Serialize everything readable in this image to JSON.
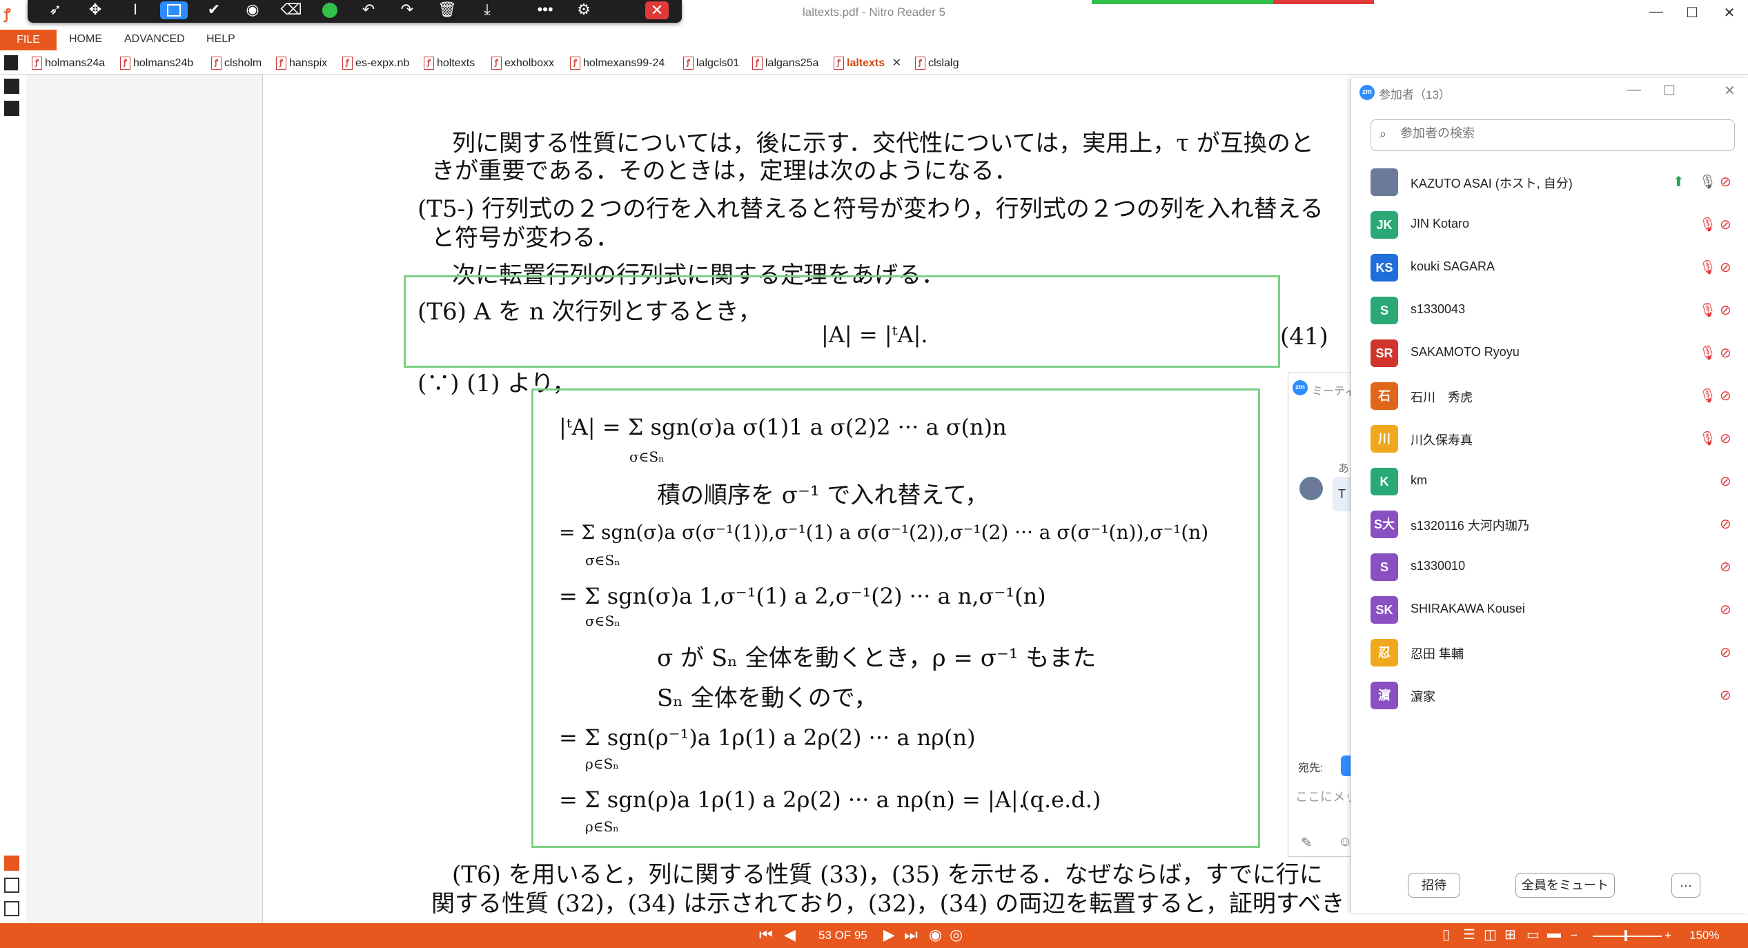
{
  "window": {
    "title": "laltexts.pdf - Nitro Reader 5",
    "min": "—",
    "max": "☐",
    "close": "✕"
  },
  "menu": {
    "file": "FILE",
    "home": "HOME",
    "advanced": "ADVANCED",
    "help": "HELP"
  },
  "tabs": [
    "holmans24a",
    "holmans24b",
    "clsholm",
    "hanspix",
    "es-expx.nb",
    "holtexts",
    "exholboxx",
    "holmexans99-24",
    "lalgcls01",
    "lalgans25a",
    "laltexts",
    "clslalg"
  ],
  "active_tab": "laltexts",
  "tab_close": "✕",
  "document": {
    "p1_l1": "列に関する性質については，後に示す．交代性については，実用上，τ が互換のと",
    "p1_l2": "きが重要である．そのときは，定理は次のようになる．",
    "t5_l1": "(T5-) 行列式の２つの行を入れ替えると符号が変わり，行列式の２つの列を入れ替える",
    "t5_l2": "と符号が変わる．",
    "next": "次に転置行列の行列式に関する定理をあげる．",
    "t6_l1": "(T6) A を n 次行列とするとき，",
    "t6_eq": "|A| = |ᵗA|.",
    "eq_num": "(41)",
    "because": "(∵) (1) より，",
    "proof_1": "|ᵗA| = Σ sgn(σ)a σ(1)1 a σ(2)2 ··· a σ(n)n",
    "proof_1_sub": "σ∈Sₙ",
    "proof_2": "積の順序を σ⁻¹ で入れ替えて，",
    "proof_3": "= Σ sgn(σ)a σ(σ⁻¹(1)),σ⁻¹(1) a σ(σ⁻¹(2)),σ⁻¹(2) ··· a σ(σ⁻¹(n)),σ⁻¹(n)",
    "proof_4": "= Σ sgn(σ)a 1,σ⁻¹(1) a 2,σ⁻¹(2) ··· a n,σ⁻¹(n)",
    "proof_5": "σ が Sₙ 全体を動くとき，ρ = σ⁻¹ もまた",
    "proof_6": "Sₙ 全体を動くので，",
    "proof_7": "= Σ sgn(ρ⁻¹)a 1ρ(1) a 2ρ(2) ··· a nρ(n)",
    "proof_8": "= Σ sgn(ρ)a 1ρ(1) a 2ρ(2) ··· a nρ(n) = |A|.",
    "qed": "(q.e.d.)",
    "sub_rho": "ρ∈Sₙ",
    "last_l1": "(T6) を用いると，列に関する性質 (33)，(35) を示せる．なぜならば，すでに行に",
    "last_l2": "関する性質 (32)，(34) は示されており，(32)，(34) の両辺を転置すると，証明すべき"
  },
  "participants_panel": {
    "title": "参加者（13）",
    "search_placeholder": "参加者の検索",
    "zm": "zm",
    "invite": "招待",
    "mute_all": "全員をミュート",
    "more": "···",
    "list": [
      {
        "initials": "",
        "name": "KAZUTO ASAI (ホスト, 自分)",
        "color": "#6b7a99"
      },
      {
        "initials": "JK",
        "name": "JIN Kotaro",
        "color": "#2aa876"
      },
      {
        "initials": "KS",
        "name": "kouki SAGARA",
        "color": "#1e6fd9"
      },
      {
        "initials": "S",
        "name": "s1330043",
        "color": "#2aa876"
      },
      {
        "initials": "SR",
        "name": "SAKAMOTO Ryoyu",
        "color": "#d0342c"
      },
      {
        "initials": "石",
        "name": "石川　秀虎",
        "color": "#e0661a"
      },
      {
        "initials": "川",
        "name": "川久保寿真",
        "color": "#f0a81e"
      },
      {
        "initials": "K",
        "name": "km",
        "color": "#2aa876"
      },
      {
        "initials": "S大",
        "name": "s1320116 大河内珈乃",
        "color": "#8a4fc0"
      },
      {
        "initials": "S",
        "name": "s1330010",
        "color": "#8a4fc0"
      },
      {
        "initials": "SK",
        "name": "SHIRAKAWA Kousei",
        "color": "#8a4fc0"
      },
      {
        "initials": "忍",
        "name": "忍田 隼輔",
        "color": "#f0a81e"
      },
      {
        "initials": "濵",
        "name": "濵家",
        "color": "#8a4fc0"
      }
    ]
  },
  "chat_window": {
    "title": "ミーティ",
    "to_label": "宛先:",
    "input_placeholder": "ここにメッ",
    "partial1": "あ",
    "partial2": "T"
  },
  "statusbar": {
    "page": "53 OF 95",
    "zoom": "150%",
    "minus": "−",
    "plus": "+"
  }
}
